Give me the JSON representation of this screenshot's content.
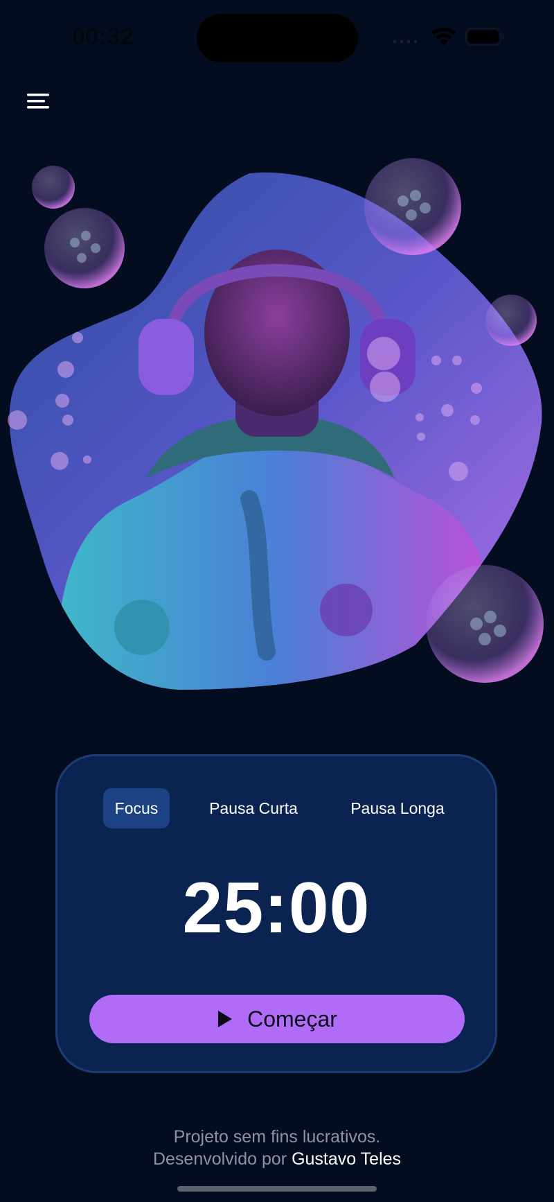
{
  "status_bar": {
    "time": "00:32",
    "icons": [
      "signal-icon",
      "wifi-icon",
      "battery-icon"
    ]
  },
  "header": {
    "menu_icon": "hamburger-menu-icon"
  },
  "hero_image": {
    "subject": "hero-artwork"
  },
  "timer_card": {
    "tabs": [
      {
        "label": "Focus",
        "active": true
      },
      {
        "label": "Pausa Curta",
        "active": false
      },
      {
        "label": "Pausa Longa",
        "active": false
      }
    ],
    "time": "25:00",
    "start_label": "Começar",
    "start_icon": "play-icon"
  },
  "footer": {
    "line1": "Projeto sem fins lucrativos.",
    "line2_prefix": "Desenvolvido por ",
    "author": "Gustavo Teles"
  },
  "colors": {
    "background": "#040d1f",
    "card": "#0b2350",
    "card_border": "#1d3c75",
    "active_tab": "#1c4283",
    "accent_button": "#b06cf7"
  }
}
